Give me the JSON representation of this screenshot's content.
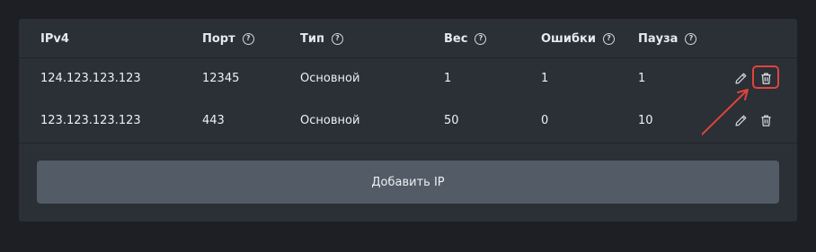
{
  "table": {
    "columns": [
      {
        "label": "IPv4",
        "help": false
      },
      {
        "label": "Порт",
        "help": true
      },
      {
        "label": "Тип",
        "help": true
      },
      {
        "label": "Вес",
        "help": true
      },
      {
        "label": "Ошибки",
        "help": true
      },
      {
        "label": "Пауза",
        "help": true
      }
    ],
    "rows": [
      {
        "ip": "124.123.123.123",
        "port": "12345",
        "type": "Основной",
        "weight": "1",
        "errors": "1",
        "pause": "1"
      },
      {
        "ip": "123.123.123.123",
        "port": "443",
        "type": "Основной",
        "weight": "50",
        "errors": "0",
        "pause": "10"
      }
    ]
  },
  "help_glyph": "?",
  "add_button_label": "Добавить IP",
  "icons": {
    "help": "question-circle-icon",
    "edit": "pencil-icon",
    "delete": "trash-icon"
  },
  "colors": {
    "background": "#1d1f24",
    "panel": "#2b2f36",
    "button": "#535b66",
    "highlight": "#e0443e"
  }
}
